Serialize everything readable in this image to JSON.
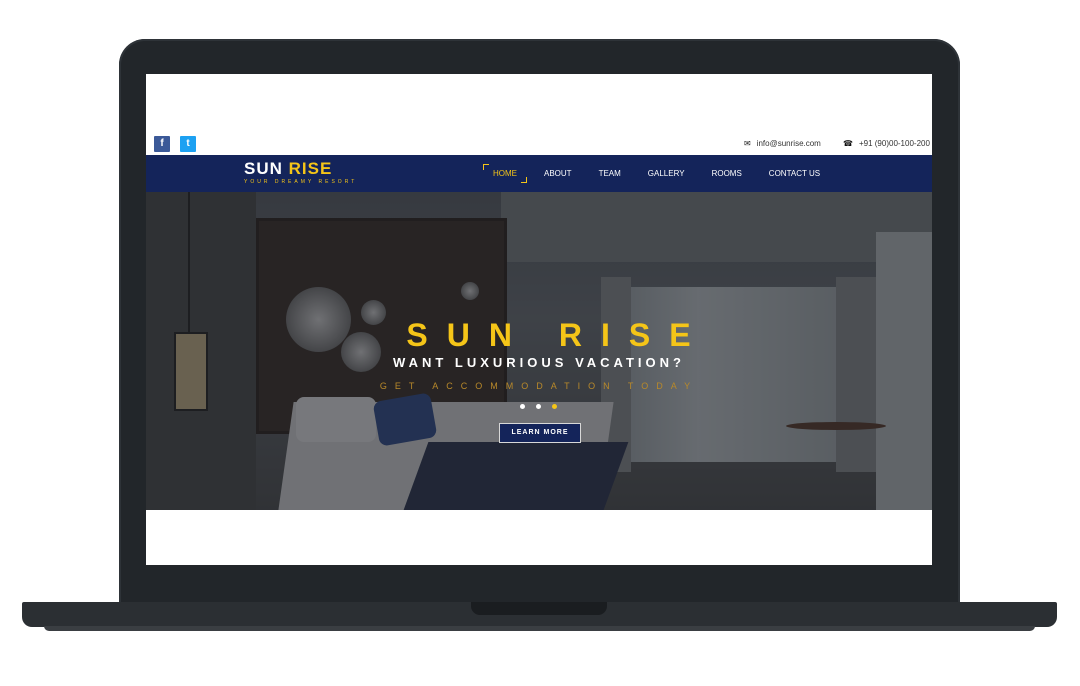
{
  "topbar": {
    "social": [
      {
        "icon": "facebook-icon",
        "glyph": "f"
      },
      {
        "icon": "twitter-icon",
        "glyph": "t"
      }
    ],
    "email": "info@sunrise.com",
    "phone": "+91 (90)00-100-200"
  },
  "brand": {
    "name_first": "SUN",
    "name_second": "RISE",
    "tagline": "YOUR DREAMY RESORT"
  },
  "nav": {
    "items": [
      {
        "label": "HOME",
        "active": true
      },
      {
        "label": "ABOUT",
        "active": false
      },
      {
        "label": "TEAM",
        "active": false
      },
      {
        "label": "GALLERY",
        "active": false
      },
      {
        "label": "ROOMS",
        "active": false
      },
      {
        "label": "CONTACT US",
        "active": false
      }
    ]
  },
  "hero": {
    "title": "SUN RISE",
    "subtitle": "WANT LUXURIOUS VACATION?",
    "tagline": "GET ACCOMMODATION TODAY",
    "cta_label": "LEARN MORE",
    "slides": 3,
    "active_slide": 3
  },
  "colors": {
    "navy": "#14245a",
    "accent": "#f5c518",
    "facebook": "#3b5998",
    "twitter": "#1da1f2"
  }
}
